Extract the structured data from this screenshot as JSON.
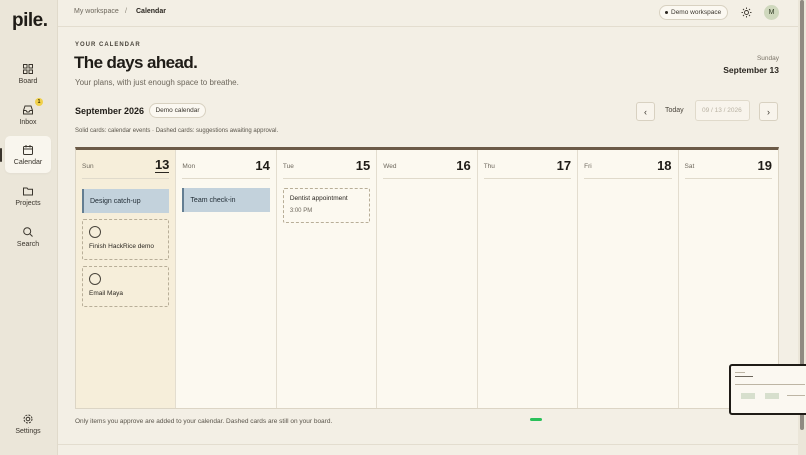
{
  "app": {
    "logo": "pile."
  },
  "sidebar": {
    "items": [
      {
        "label": "Board",
        "icon": "grid-icon"
      },
      {
        "label": "Inbox",
        "icon": "inbox-icon",
        "badge": "1"
      },
      {
        "label": "Calendar",
        "icon": "calendar-icon"
      },
      {
        "label": "Projects",
        "icon": "folder-icon"
      },
      {
        "label": "Search",
        "icon": "search-icon"
      }
    ],
    "settings": {
      "label": "Settings",
      "icon": "gear-icon"
    }
  },
  "topbar": {
    "breadcrumb": [
      "My workspace",
      "/",
      "Calendar"
    ],
    "demo_workspace": "Demo workspace",
    "avatar": "M"
  },
  "header": {
    "eyebrow": "YOUR CALENDAR",
    "title": "The days ahead.",
    "subtitle": "Your plans, with just enough space to breathe.",
    "day_label": "Sunday",
    "day_date": "September 13"
  },
  "controls": {
    "month": "September 2026",
    "demo_calendar": "Demo calendar",
    "prev": "‹",
    "today": "Today",
    "next": "›",
    "date_value": "09 / 13 / 2026"
  },
  "legend": "Solid cards: calendar events · Dashed cards: suggestions awaiting approval.",
  "days": [
    {
      "dow": "Sun",
      "num": "13"
    },
    {
      "dow": "Mon",
      "num": "14"
    },
    {
      "dow": "Tue",
      "num": "15"
    },
    {
      "dow": "Wed",
      "num": "16"
    },
    {
      "dow": "Thu",
      "num": "17"
    },
    {
      "dow": "Fri",
      "num": "18"
    },
    {
      "dow": "Sat",
      "num": "19"
    }
  ],
  "events": {
    "sun_event": "Design catch-up",
    "mon_event": "Team check-in",
    "sun_suggestion_1": "Finish HackRice demo",
    "sun_suggestion_2": "Email Maya",
    "tue_suggestion": {
      "title": "Dentist appointment",
      "time": "3:00 PM"
    }
  },
  "footer": "Only items you approve are added to your calendar. Dashed cards are still on your board.",
  "colors": {
    "accent_bar": "#6b5a47",
    "event_fill": "#c3d2dc",
    "today_fill": "#f6eeda",
    "badge": "#f0d04a"
  }
}
